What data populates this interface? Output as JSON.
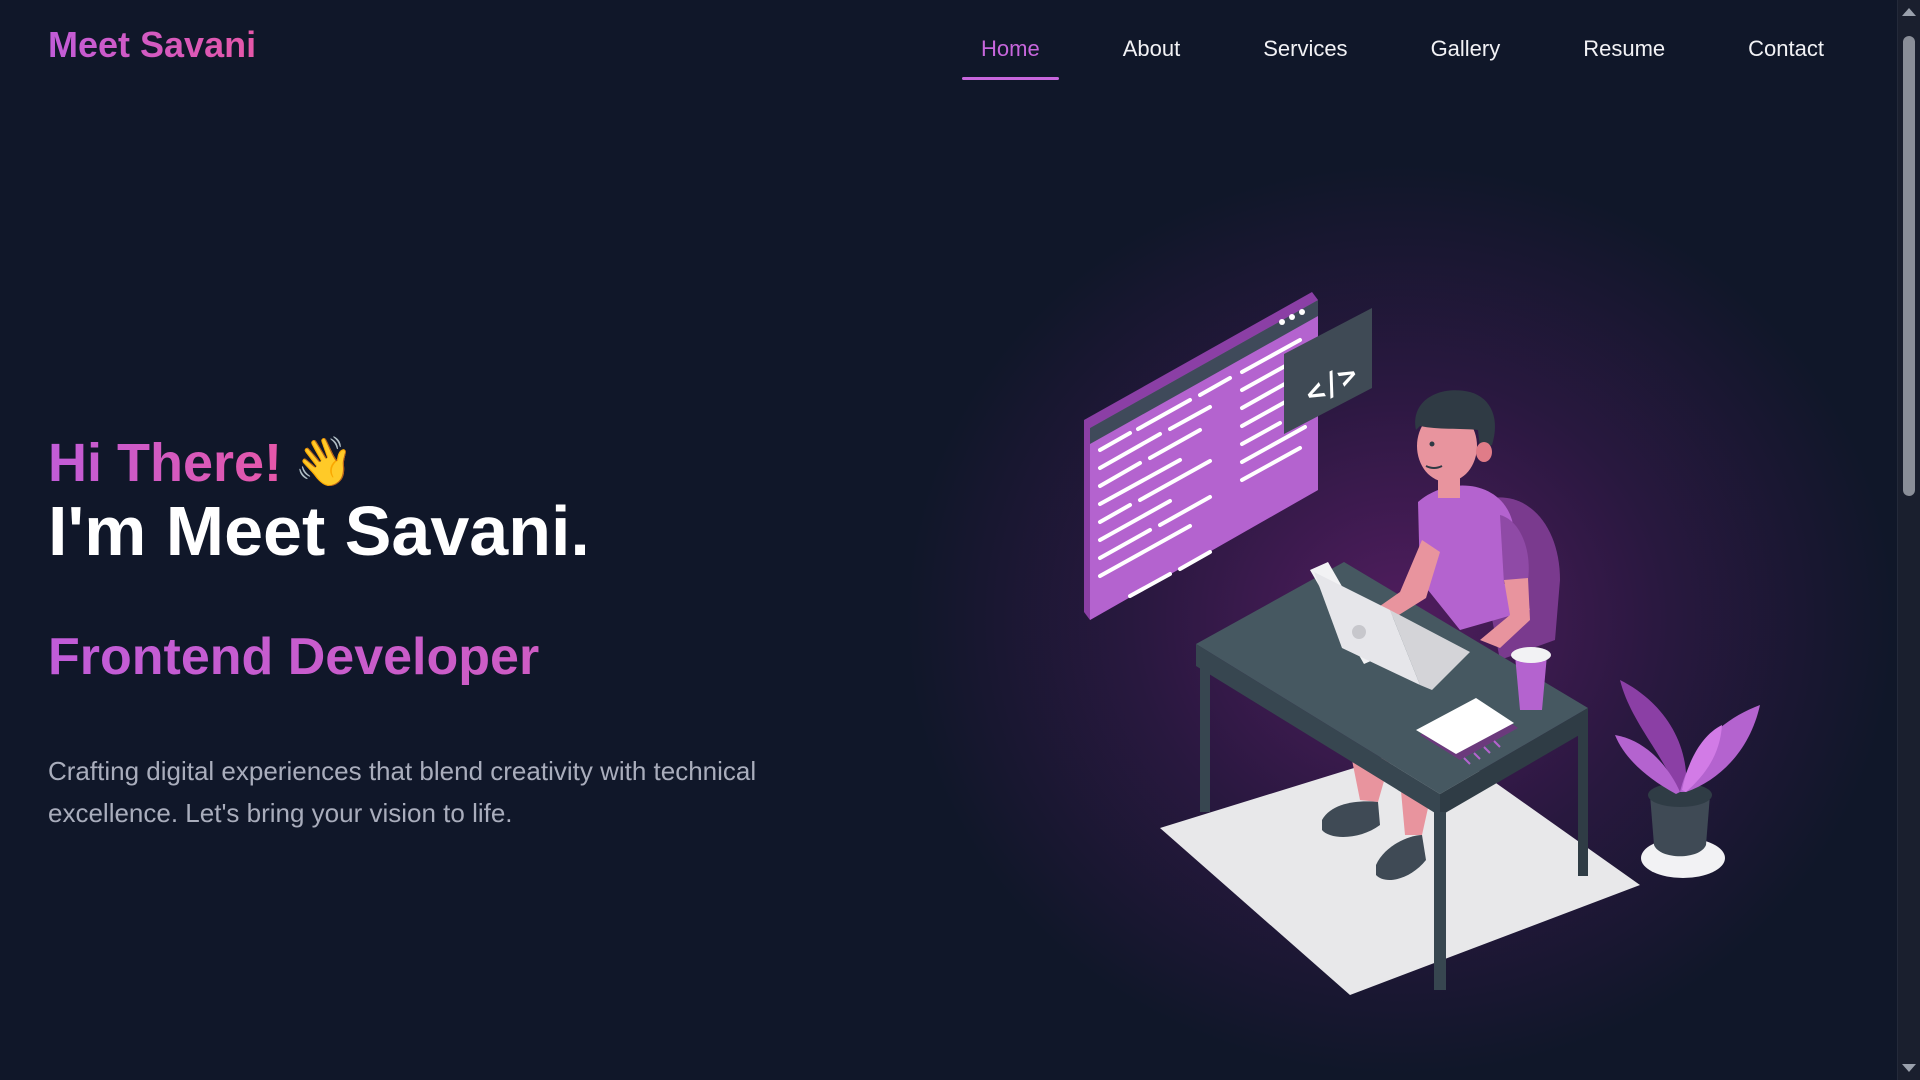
{
  "brand": {
    "name": "Meet Savani"
  },
  "nav": {
    "items": [
      {
        "label": "Home",
        "active": true
      },
      {
        "label": "About",
        "active": false
      },
      {
        "label": "Services",
        "active": false
      },
      {
        "label": "Gallery",
        "active": false
      },
      {
        "label": "Resume",
        "active": false
      },
      {
        "label": "Contact",
        "active": false
      }
    ]
  },
  "hero": {
    "greeting": "Hi There!",
    "wave_emoji": "👋",
    "name": "I'm Meet Savani.",
    "role": "Frontend Developer",
    "tagline": "Crafting digital experiences that blend creativity with technical excellence. Let's bring your vision to life."
  },
  "illustration": {
    "code_badge": "</>"
  },
  "colors": {
    "background": "#101729",
    "accent": "#c766dc",
    "accent_pink": "#e657a8",
    "text_light": "#f2f2f5",
    "text_muted": "#a9adbc",
    "desk": "#465861"
  },
  "icons": {
    "wave": "waving-hand-icon"
  }
}
